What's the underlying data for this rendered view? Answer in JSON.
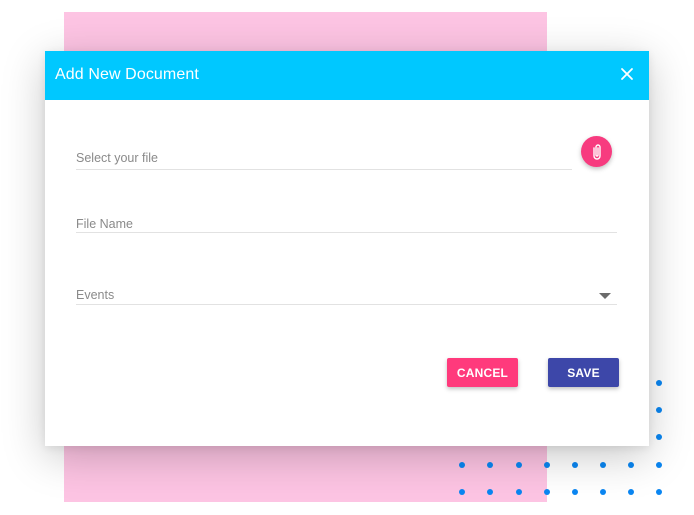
{
  "dialog": {
    "title": "Add New Document",
    "close_icon": "close-icon",
    "fields": {
      "file": {
        "placeholder": "Select your file",
        "value": ""
      },
      "file_name": {
        "placeholder": "File Name",
        "value": ""
      },
      "events": {
        "placeholder": "Events",
        "selected": ""
      }
    },
    "attach_icon": "paperclip-icon",
    "buttons": {
      "cancel_label": "CANCEL",
      "save_label": "SAVE"
    }
  },
  "colors": {
    "header": "#00c8ff",
    "attach": "#f73b7f",
    "cancel": "#ff3a7c",
    "save": "#3d47a9",
    "decor_pink": "#fdc4e3",
    "decor_dots": "#0a86f2"
  }
}
